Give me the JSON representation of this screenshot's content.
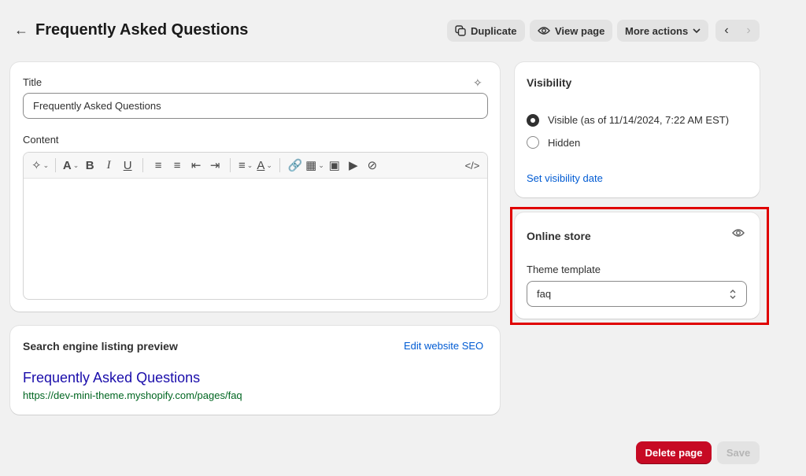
{
  "header": {
    "title": "Frequently Asked Questions",
    "actions": {
      "duplicate": "Duplicate",
      "view_page": "View page",
      "more_actions": "More actions"
    }
  },
  "main": {
    "title_label": "Title",
    "title_value": "Frequently Asked Questions",
    "content_label": "Content",
    "content_value": ""
  },
  "seo": {
    "heading": "Search engine listing preview",
    "edit_link": "Edit website SEO",
    "preview_title": "Frequently Asked Questions",
    "preview_url": "https://dev-mini-theme.myshopify.com/pages/faq"
  },
  "visibility": {
    "heading": "Visibility",
    "option_visible": "Visible (as of 11/14/2024, 7:22 AM EST)",
    "option_hidden": "Hidden",
    "selected": "visible",
    "set_date_link": "Set visibility date"
  },
  "online_store": {
    "heading": "Online store",
    "theme_template_label": "Theme template",
    "theme_template_value": "faq"
  },
  "footer": {
    "delete": "Delete page",
    "save": "Save"
  },
  "colors": {
    "accent_link": "#005bd3",
    "danger": "#c70a24",
    "highlight": "#e00000"
  }
}
